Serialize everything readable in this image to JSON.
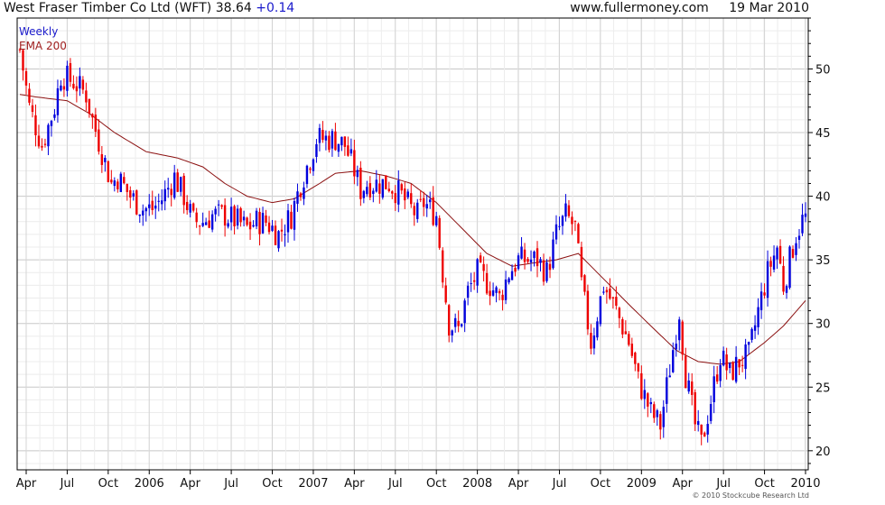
{
  "header": {
    "title": "West Fraser Timber Co Ltd (WFT)",
    "price": "38.64",
    "change": "+0.14",
    "website": "www.fullermoney.com",
    "date": "19 Mar 2010"
  },
  "footer": {
    "copyright": "© 2010 Stockcube Research Ltd"
  },
  "colors": {
    "up_bar": "#0000dd",
    "down_bar": "#ee0000",
    "ema_line": "#8b1010",
    "grid": "#cccccc",
    "axis": "#000000"
  },
  "chart_data": {
    "type": "candlestick",
    "interval": "Weekly",
    "grid": true,
    "y_axis_side": "right",
    "ylim": [
      18.5,
      54
    ],
    "y_ticks": [
      20,
      25,
      30,
      35,
      40,
      45,
      50
    ],
    "x_tick_labels": [
      "Apr",
      "Jul",
      "Oct",
      "2006",
      "Apr",
      "Jul",
      "Oct",
      "2007",
      "Apr",
      "Jul",
      "Oct",
      "2008",
      "Apr",
      "Jul",
      "Oct",
      "2009",
      "Apr",
      "Jul",
      "Oct",
      "2010"
    ],
    "weeks": 250,
    "series": [
      {
        "name": "Weekly",
        "role": "price",
        "anchors": [
          [
            0,
            51.5
          ],
          [
            3,
            47
          ],
          [
            7,
            44
          ],
          [
            11,
            47
          ],
          [
            13,
            49.5
          ],
          [
            17,
            49
          ],
          [
            21,
            48
          ],
          [
            23,
            46
          ],
          [
            26,
            43.5
          ],
          [
            29,
            41
          ],
          [
            31,
            41.5
          ],
          [
            35,
            40
          ],
          [
            39,
            39
          ],
          [
            42,
            39
          ],
          [
            45,
            39.8
          ],
          [
            49,
            41.5
          ],
          [
            52,
            40
          ],
          [
            55,
            38
          ],
          [
            58,
            38
          ],
          [
            61,
            38.5
          ],
          [
            65,
            38.5
          ],
          [
            69,
            38
          ],
          [
            72,
            37.5
          ],
          [
            75,
            38
          ],
          [
            78,
            38
          ],
          [
            82,
            37
          ],
          [
            86,
            38.5
          ],
          [
            89,
            41
          ],
          [
            92,
            43
          ],
          [
            94,
            44.5
          ],
          [
            97,
            44.5
          ],
          [
            100,
            44.5
          ],
          [
            103,
            44
          ],
          [
            106,
            42
          ],
          [
            108,
            40.5
          ],
          [
            110,
            41
          ],
          [
            114,
            41
          ],
          [
            117,
            41
          ],
          [
            121,
            40
          ],
          [
            124,
            39
          ],
          [
            126,
            38.5
          ],
          [
            128,
            39.5
          ],
          [
            132,
            38.5
          ],
          [
            134,
            34
          ],
          [
            136,
            30
          ],
          [
            139,
            29.5
          ],
          [
            142,
            32.5
          ],
          [
            145,
            34
          ],
          [
            149,
            33
          ],
          [
            152,
            32
          ],
          [
            155,
            34
          ],
          [
            158,
            35
          ],
          [
            161,
            35
          ],
          [
            164,
            35
          ],
          [
            167,
            34
          ],
          [
            170,
            37
          ],
          [
            173,
            38.5
          ],
          [
            176,
            37.5
          ],
          [
            178,
            33
          ],
          [
            181,
            28.5
          ],
          [
            185,
            33
          ],
          [
            189,
            31
          ],
          [
            193,
            28.5
          ],
          [
            196,
            25.5
          ],
          [
            200,
            23
          ],
          [
            203,
            22
          ],
          [
            207,
            28
          ],
          [
            209,
            31
          ],
          [
            211,
            26
          ],
          [
            214,
            22
          ],
          [
            216,
            20.5
          ],
          [
            219,
            24
          ],
          [
            222,
            27.5
          ],
          [
            225,
            26
          ],
          [
            228,
            27
          ],
          [
            231,
            27.5
          ],
          [
            234,
            31
          ],
          [
            237,
            34
          ],
          [
            240,
            36
          ],
          [
            242,
            33
          ],
          [
            244,
            35
          ],
          [
            246,
            37
          ],
          [
            249,
            38.64
          ]
        ]
      },
      {
        "name": "EMA 200",
        "role": "ema",
        "anchors": [
          [
            0,
            48
          ],
          [
            5,
            47.8
          ],
          [
            15,
            47.5
          ],
          [
            22,
            46.5
          ],
          [
            30,
            45
          ],
          [
            40,
            43.5
          ],
          [
            50,
            43
          ],
          [
            58,
            42.3
          ],
          [
            65,
            41
          ],
          [
            72,
            40
          ],
          [
            80,
            39.5
          ],
          [
            87,
            39.8
          ],
          [
            95,
            41
          ],
          [
            100,
            41.8
          ],
          [
            108,
            42
          ],
          [
            116,
            41.6
          ],
          [
            124,
            41
          ],
          [
            132,
            39.5
          ],
          [
            140,
            37.5
          ],
          [
            148,
            35.5
          ],
          [
            156,
            34.5
          ],
          [
            164,
            34.8
          ],
          [
            170,
            35
          ],
          [
            177,
            35.5
          ],
          [
            185,
            33.5
          ],
          [
            193,
            31.5
          ],
          [
            200,
            29.8
          ],
          [
            208,
            27.9
          ],
          [
            215,
            27
          ],
          [
            222,
            26.8
          ],
          [
            228,
            27
          ],
          [
            236,
            28.5
          ],
          [
            242,
            29.8
          ],
          [
            249,
            31.8
          ]
        ]
      }
    ]
  }
}
